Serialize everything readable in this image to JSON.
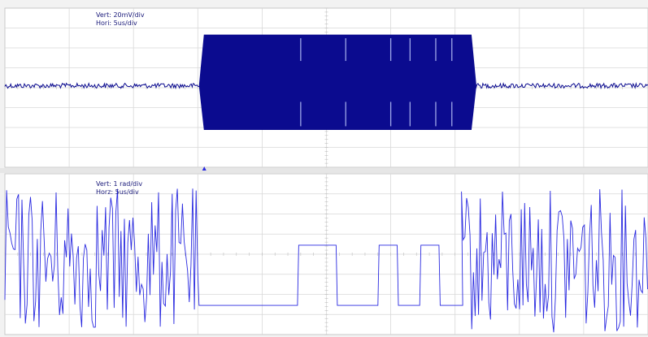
{
  "chart_data": [
    {
      "type": "line",
      "panel": "top",
      "annotations": [
        "Vert: 20mV/div",
        "Hori: 5us/div"
      ],
      "divisions": {
        "x": 10,
        "y": 8
      },
      "baseline_div": 3.9,
      "noise_div": 0.12,
      "burst": {
        "start_div": 3.1,
        "end_div": 7.25,
        "top_div": 1.35,
        "bottom_div": 6.1,
        "gap_positions_div": [
          4.6,
          5.3,
          6.0,
          6.3,
          6.7,
          6.95
        ]
      },
      "line_color": "#0b0b8f"
    },
    {
      "type": "line",
      "panel": "bottom",
      "annotations": [
        "Vert: 1 rad/div",
        "Horz: 5us/div"
      ],
      "divisions": {
        "x": 10,
        "y": 8
      },
      "noisy_segments_div": [
        [
          0.0,
          3.0
        ],
        [
          7.1,
          10.0
        ]
      ],
      "noise_range_div": [
        0.7,
        7.9
      ],
      "low_level_div": 6.55,
      "high_level_div": 3.55,
      "steps_div": [
        [
          3.0,
          6.55
        ],
        [
          4.55,
          3.55
        ],
        [
          5.15,
          6.55
        ],
        [
          5.8,
          3.55
        ],
        [
          6.1,
          6.55
        ],
        [
          6.45,
          3.55
        ],
        [
          6.75,
          6.55
        ],
        [
          7.1,
          6.55
        ]
      ],
      "line_color": "#2a2ae0"
    }
  ],
  "trigger_marker_div": 3.1
}
